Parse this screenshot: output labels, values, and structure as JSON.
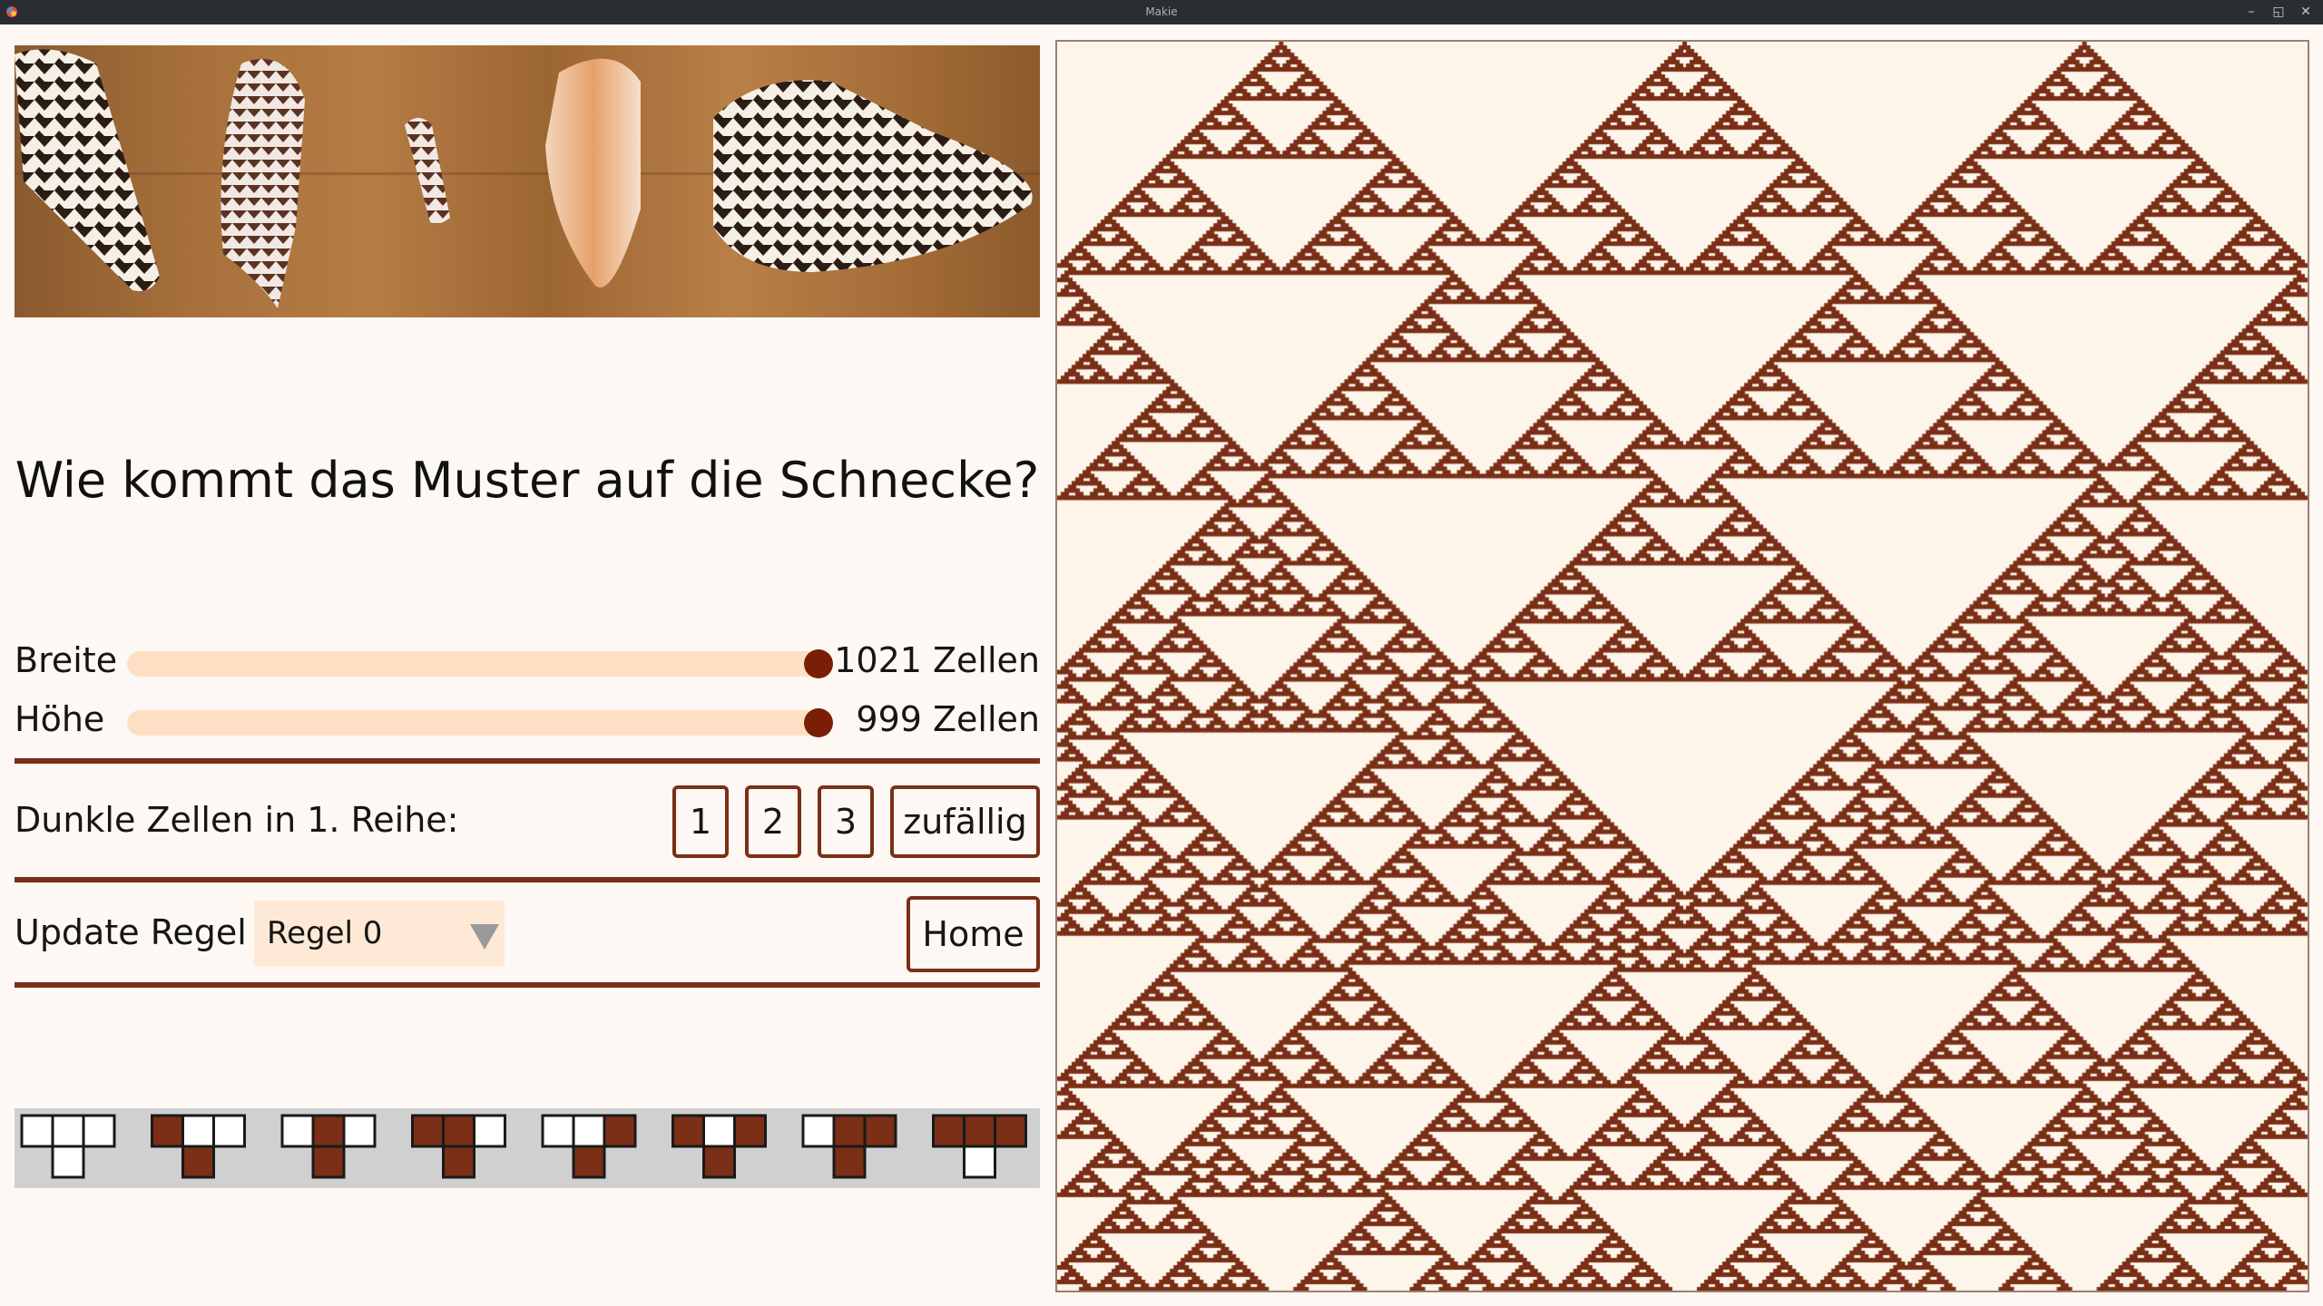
{
  "window": {
    "title": "Makie"
  },
  "heading": "Wie kommt das Muster auf die Schnecke?",
  "sliders": [
    {
      "label": "Breite",
      "value_text": "1021 Zellen",
      "level": 1.0
    },
    {
      "label": "Höhe",
      "value_text": "999 Zellen",
      "level": 1.0
    }
  ],
  "dark_cells": {
    "label": "Dunkle Zellen in 1. Reihe:",
    "buttons": [
      "1",
      "2",
      "3",
      "zufällig"
    ]
  },
  "update_rule": {
    "label": "Update Regel",
    "selected": "Regel 0",
    "home_label": "Home"
  },
  "rule_patterns": [
    {
      "top": [
        0,
        0,
        0
      ],
      "bottom": 0
    },
    {
      "top": [
        1,
        0,
        0
      ],
      "bottom": 1
    },
    {
      "top": [
        0,
        1,
        0
      ],
      "bottom": 1
    },
    {
      "top": [
        1,
        1,
        0
      ],
      "bottom": 1
    },
    {
      "top": [
        0,
        0,
        1
      ],
      "bottom": 1
    },
    {
      "top": [
        1,
        0,
        1
      ],
      "bottom": 1
    },
    {
      "top": [
        0,
        1,
        1
      ],
      "bottom": 1
    },
    {
      "top": [
        1,
        1,
        1
      ],
      "bottom": 0
    }
  ],
  "colors": {
    "dark_cell": "#7a2f16",
    "light_cell": "#fdf4ea",
    "slider_track": "#fde0c4",
    "slider_knob": "#7a1f05",
    "strip_bg": "#d0d0d0"
  },
  "icons": {
    "window": [
      "app-icon",
      "minimize-icon",
      "maximize-icon",
      "close-icon"
    ],
    "dropdown": "triangle-down-icon"
  }
}
